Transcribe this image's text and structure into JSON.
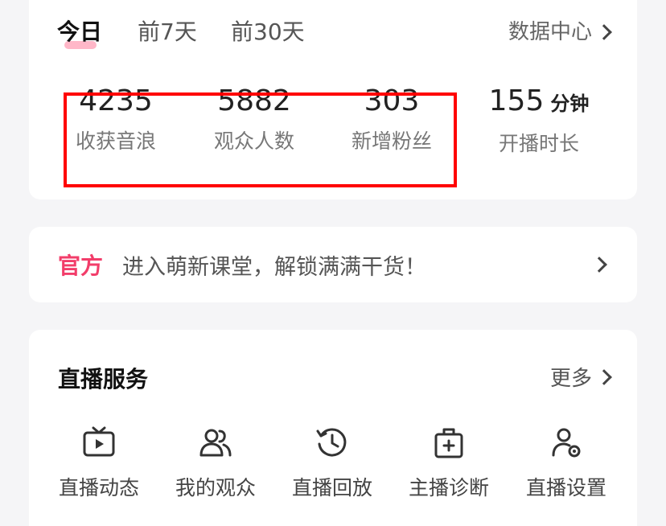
{
  "tabs": [
    {
      "label": "今日",
      "active": true
    },
    {
      "label": "前7天",
      "active": false
    },
    {
      "label": "前30天",
      "active": false
    }
  ],
  "data_center_label": "数据中心",
  "stats": [
    {
      "value": "4235",
      "label": "收获音浪"
    },
    {
      "value": "5882",
      "label": "观众人数"
    },
    {
      "value": "303",
      "label": "新增粉丝"
    },
    {
      "value": "155",
      "unit": "分钟",
      "label": "开播时长"
    }
  ],
  "banner": {
    "tag": "官方",
    "text": "进入萌新课堂，解锁满满干货！"
  },
  "services": {
    "title": "直播服务",
    "more_label": "更多",
    "items": [
      {
        "label": "直播动态",
        "icon": "tv-play-icon"
      },
      {
        "label": "我的观众",
        "icon": "users-icon"
      },
      {
        "label": "直播回放",
        "icon": "history-clock-icon"
      },
      {
        "label": "主播诊断",
        "icon": "medical-kit-icon"
      },
      {
        "label": "直播设置",
        "icon": "user-settings-icon"
      }
    ]
  },
  "colors": {
    "accent_pink": "#f23d6a",
    "highlight_red": "#ff0000",
    "tab_underline": "#ffb7c8"
  }
}
